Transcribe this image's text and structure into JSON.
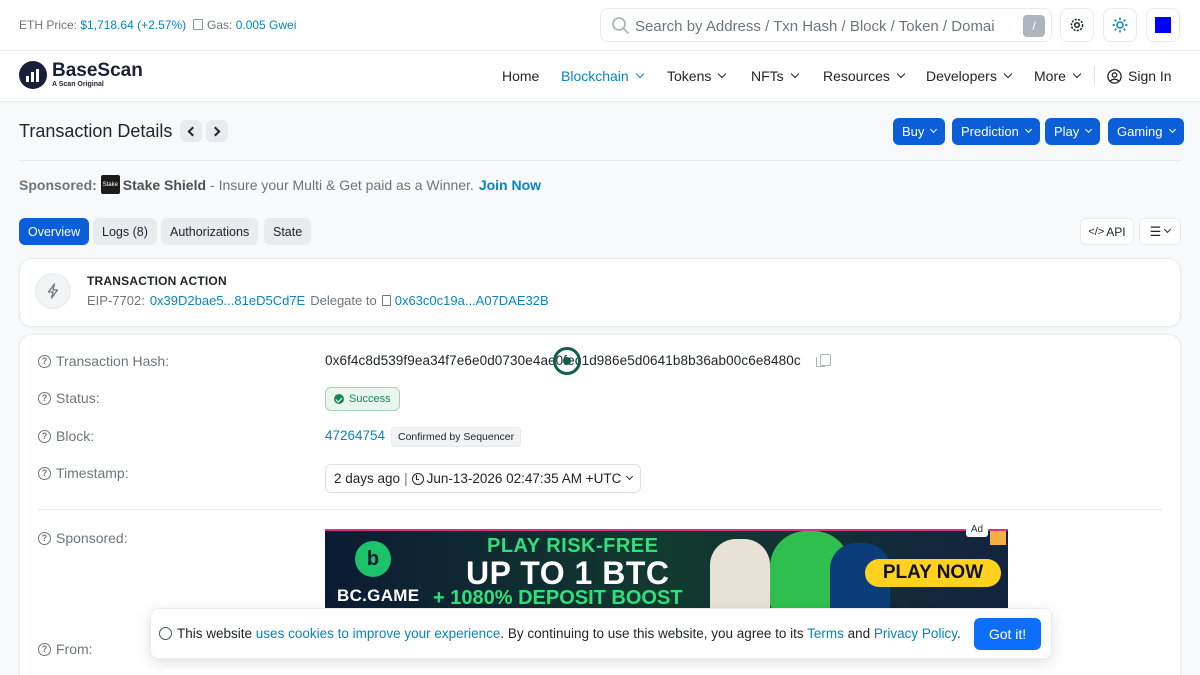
{
  "topbar": {
    "eth_price_label": "ETH Price:",
    "eth_price_value": "$1,718.64 (+2.57%)",
    "gas_label": "Gas:",
    "gas_value": "0.005 Gwei",
    "search_placeholder": "Search by Address / Txn Hash / Block / Token / Domai",
    "search_shortcut": "/"
  },
  "brand": {
    "name": "BaseScan",
    "tagline": "A Scan Original"
  },
  "nav": {
    "home": "Home",
    "blockchain": "Blockchain",
    "tokens": "Tokens",
    "nfts": "NFTs",
    "resources": "Resources",
    "developers": "Developers",
    "more": "More",
    "sign_in": "Sign In"
  },
  "page": {
    "title": "Transaction Details",
    "buttons": {
      "buy": "Buy",
      "prediction": "Prediction",
      "play": "Play",
      "gaming": "Gaming"
    }
  },
  "sponsor": {
    "label": "Sponsored:",
    "logo_text": "Stake",
    "brand": "Stake Shield",
    "text": "- Insure your Multi & Get paid as a Winner.",
    "cta": "Join Now"
  },
  "tabs": {
    "overview": "Overview",
    "logs": "Logs (8)",
    "authorizations": "Authorizations",
    "state": "State",
    "api": "API"
  },
  "action": {
    "title": "TRANSACTION ACTION",
    "type": "EIP-7702:",
    "address": "0x39D2bae5...81eD5Cd7E",
    "delegate_label": "Delegate to",
    "delegate_address": "0x63c0c19a...A07DAE32B"
  },
  "details": {
    "hash_label": "Transaction Hash:",
    "hash_value": "0x6f4c8d539f9ea34f7e6e0d0730e4ae0fec1d986e5d0641b8b36ab00c6e8480c",
    "status_label": "Status:",
    "status_value": "Success",
    "block_label": "Block:",
    "block_value": "47264754",
    "block_badge": "Confirmed by Sequencer",
    "timestamp_label": "Timestamp:",
    "timestamp_age": "2 days ago",
    "timestamp_sep": "|",
    "timestamp_value": "Jun-13-2026 02:47:35 AM +UTC",
    "sponsored_label": "Sponsored:",
    "from_label": "From:"
  },
  "ad": {
    "brand": "BC.GAME",
    "line1": "PLAY RISK-FREE",
    "line2": "UP TO 1 BTC",
    "line3": "+ 1080% DEPOSIT BOOST",
    "cta": "PLAY NOW",
    "tag": "Ad"
  },
  "cookie": {
    "t1": "This website",
    "link1": "uses cookies to improve your experience",
    "t2": ". By continuing to use this website, you agree to its",
    "link2": "Terms",
    "t3": "and",
    "link3": "Privacy Policy",
    "t4": ".",
    "button": "Got it!"
  },
  "colors": {
    "accent": "#0784c3",
    "primary_button": "#0b5ed7",
    "success": "#198754"
  }
}
